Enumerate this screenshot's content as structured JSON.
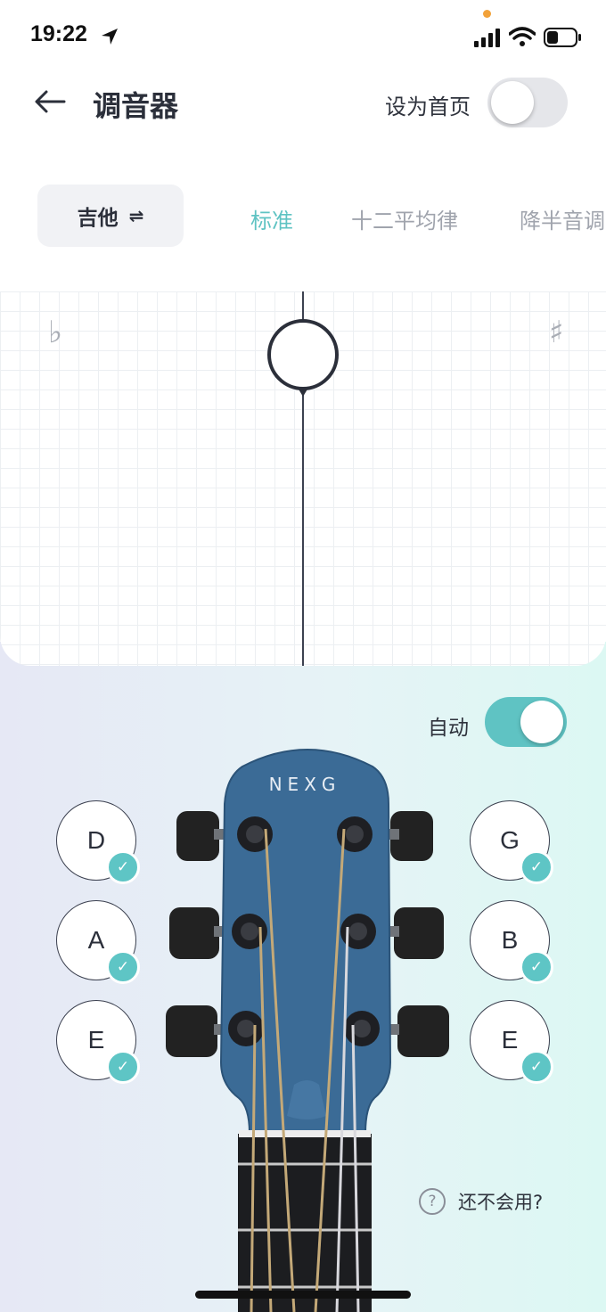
{
  "status_bar": {
    "time": "19:22"
  },
  "header": {
    "title": "调音器",
    "set_home_label": "设为首页",
    "set_home_on": false
  },
  "instrument": {
    "label": "吉他",
    "swap_icon": "⇌"
  },
  "tabs": [
    {
      "label": "标准",
      "active": true
    },
    {
      "label": "十二平均律",
      "active": false
    },
    {
      "label": "降半音调",
      "active": false
    }
  ],
  "tuner": {
    "flat_symbol": "♭",
    "sharp_symbol": "♯"
  },
  "auto": {
    "label": "自动",
    "on": true
  },
  "guitar": {
    "brand": "NEXG"
  },
  "strings_left": [
    {
      "note": "D",
      "tuned": true
    },
    {
      "note": "A",
      "tuned": true
    },
    {
      "note": "E",
      "tuned": true
    }
  ],
  "strings_right": [
    {
      "note": "G",
      "tuned": true
    },
    {
      "note": "B",
      "tuned": true
    },
    {
      "note": "E",
      "tuned": true
    }
  ],
  "help": {
    "icon": "?",
    "label": "还不会用?"
  },
  "colors": {
    "accent": "#5fc3c3",
    "guitar_blue": "#3b6b96",
    "text": "#2b2f3a"
  }
}
